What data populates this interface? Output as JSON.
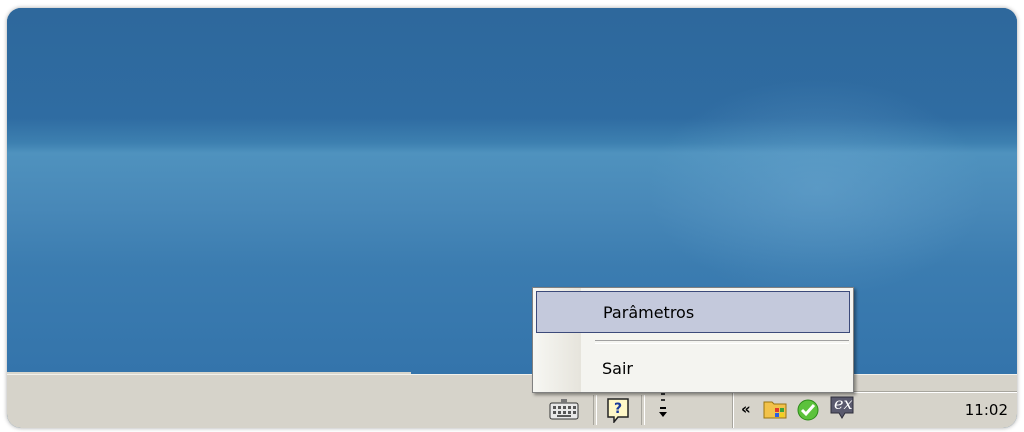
{
  "context_menu": {
    "items": [
      {
        "label": "Parâmetros",
        "highlighted": true
      },
      {
        "label": "Sair",
        "highlighted": false
      }
    ]
  },
  "taskbar": {
    "quicklaunch_icons": [
      "keyboard-icon",
      "help-icon"
    ],
    "tray_expand_glyph": "«",
    "tray_icons": [
      "folder-network-icon",
      "security-check-icon",
      "ex-app-icon"
    ],
    "tray_ex_text": "ex",
    "clock": "11:02"
  },
  "colors": {
    "desktop": "#2f6ca2",
    "menu_highlight": "#c4c9dc",
    "menu_highlight_border": "#3c4a7a",
    "taskbar": "#d6d3ca"
  }
}
